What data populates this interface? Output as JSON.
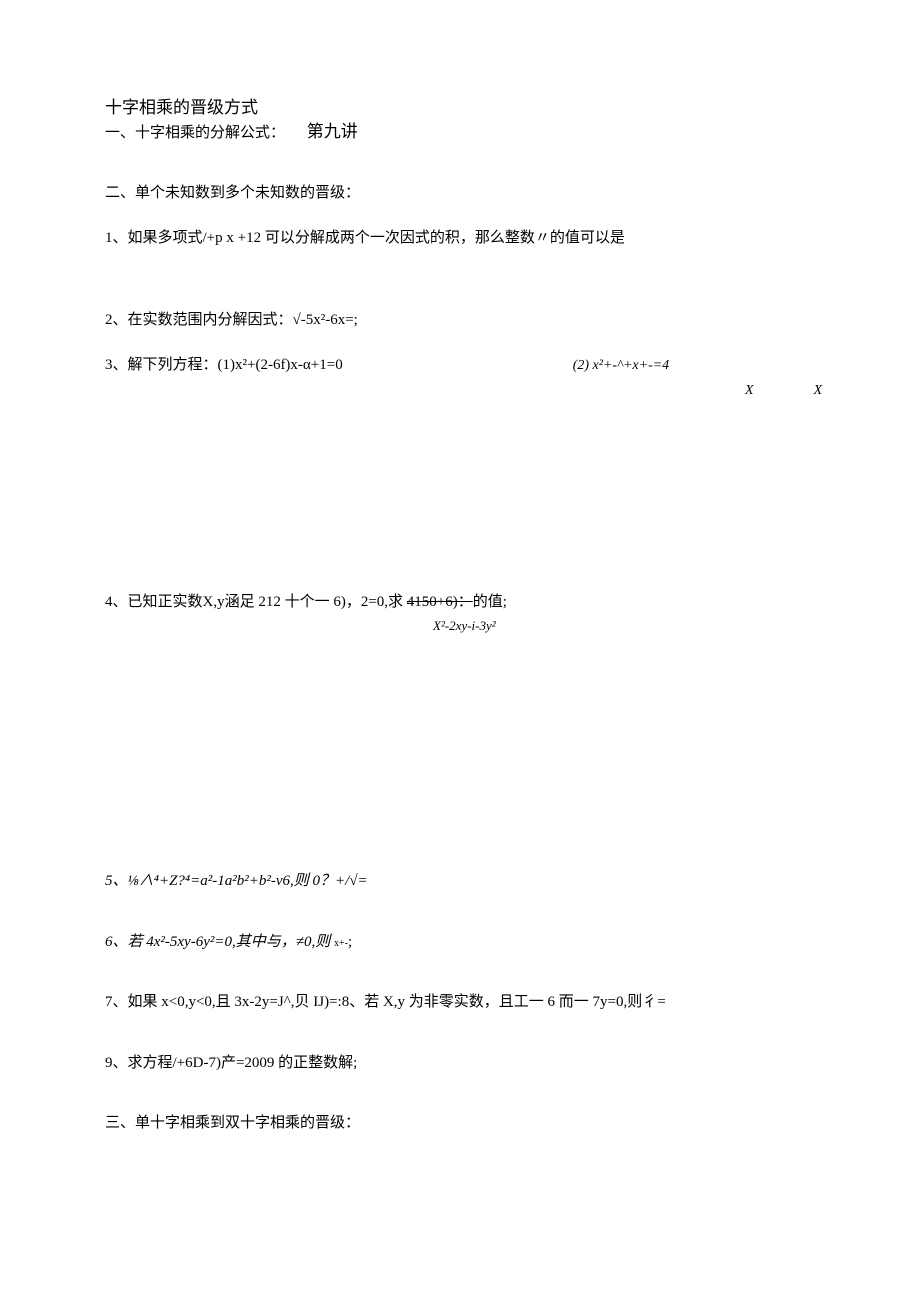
{
  "header": {
    "main_title": "十字相乘的晋级方式",
    "section1": "一、十字相乘的分解公式：",
    "lecture": "第九讲"
  },
  "section2": "二、单个未知数到多个未知数的晋级：",
  "q1": "1、如果多项式/+p x +12 可以分解成两个一次因式的积，那么整数〃的值可以是",
  "q2": "2、在实数范围内分解因式：√-5x²-6x=;",
  "q3": {
    "left": "3、解下列方程：(1)x²+(2-6f)x-α+1=0",
    "right": "(2) x²+-^+x+-=4",
    "sub_x1": "X",
    "sub_x2": "X"
  },
  "q4": {
    "main_a": "4、已知正实数X,y涵足 212 十个一 6)，2=0,求 ",
    "strike": "4150+6)：",
    "main_b": "的值;",
    "sub": "X²-2xy-i-3y²"
  },
  "q5": "5、⅛∧⁴+Z?⁴=a²-1a²b²+b²-v6,则 0？+/√=",
  "q6": {
    "a": "6、若 4x²-5xy-6y²=0,其中与，≠0,则",
    "tiny": "x+-",
    "b": ";"
  },
  "q7": "7、如果 x<0,y<0,且 3x-2y=J^,贝 IJ)=:8、若 X,y 为非零实数，且工一 6 而一 7y=0,则彳=",
  "q9": "9、求方程/+6D-7)产=2009 的正整数解;",
  "section3": "三、单十字相乘到双十字相乘的晋级："
}
